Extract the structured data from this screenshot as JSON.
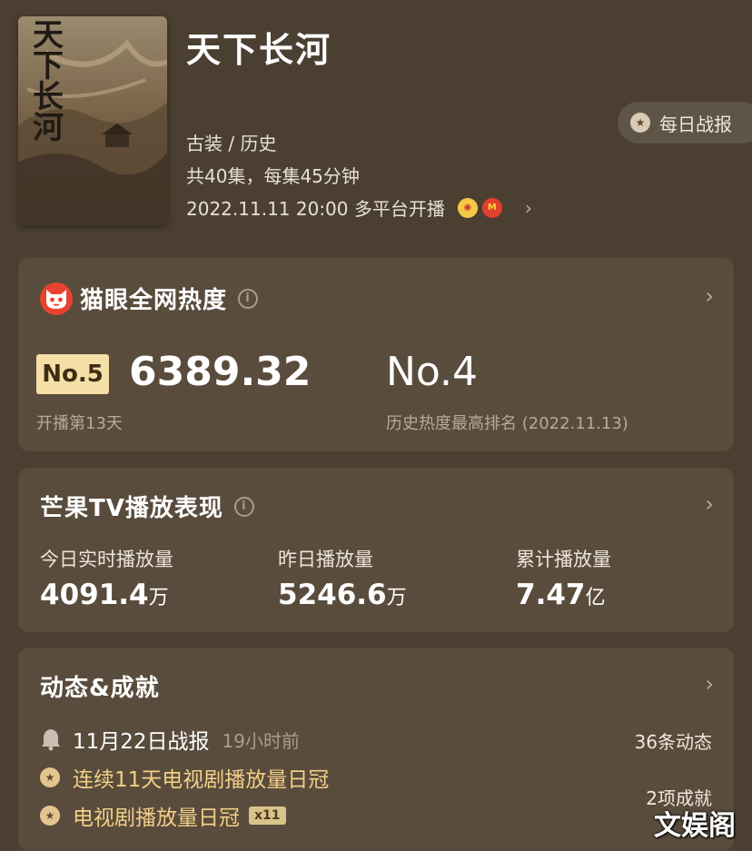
{
  "header": {
    "title": "天下长河",
    "poster_text": "天下长河",
    "genre": "古装 / 历史",
    "episodes": "共40集，每集45分钟",
    "premiere": "2022.11.11 20:00 多平台开播",
    "platforms": [
      "yellow-platform-icon",
      "mango-tv-icon"
    ],
    "daily_report_label": "每日战报"
  },
  "heat_card": {
    "title": "猫眼全网热度",
    "rank_badge": "No.5",
    "heat_value": "6389.32",
    "days_label": "开播第13天",
    "best_rank": "No.4",
    "best_rank_label": "历史热度最高排名 (2022.11.13)"
  },
  "mango_card": {
    "title": "芒果TV播放表现",
    "stats": [
      {
        "label": "今日实时播放量",
        "value": "4091.4",
        "unit": "万"
      },
      {
        "label": "昨日播放量",
        "value": "5246.6",
        "unit": "万"
      },
      {
        "label": "累计播放量",
        "value": "7.47",
        "unit": "亿"
      }
    ]
  },
  "dynamics_card": {
    "title": "动态&成就",
    "report": "11月22日战报",
    "report_time": "19小时前",
    "dynamics_count": "36条动态",
    "achievements": [
      {
        "text": "连续11天电视剧播放量日冠"
      },
      {
        "text": "电视剧播放量日冠",
        "badge": "x11"
      }
    ],
    "achievements_count": "2项成就"
  },
  "watermark": "文娱阁",
  "colors": {
    "background": "#4b3f32",
    "card": "#594c3d",
    "rank_badge": "#f5dfa6",
    "achievement_text": "#f3cf86"
  }
}
